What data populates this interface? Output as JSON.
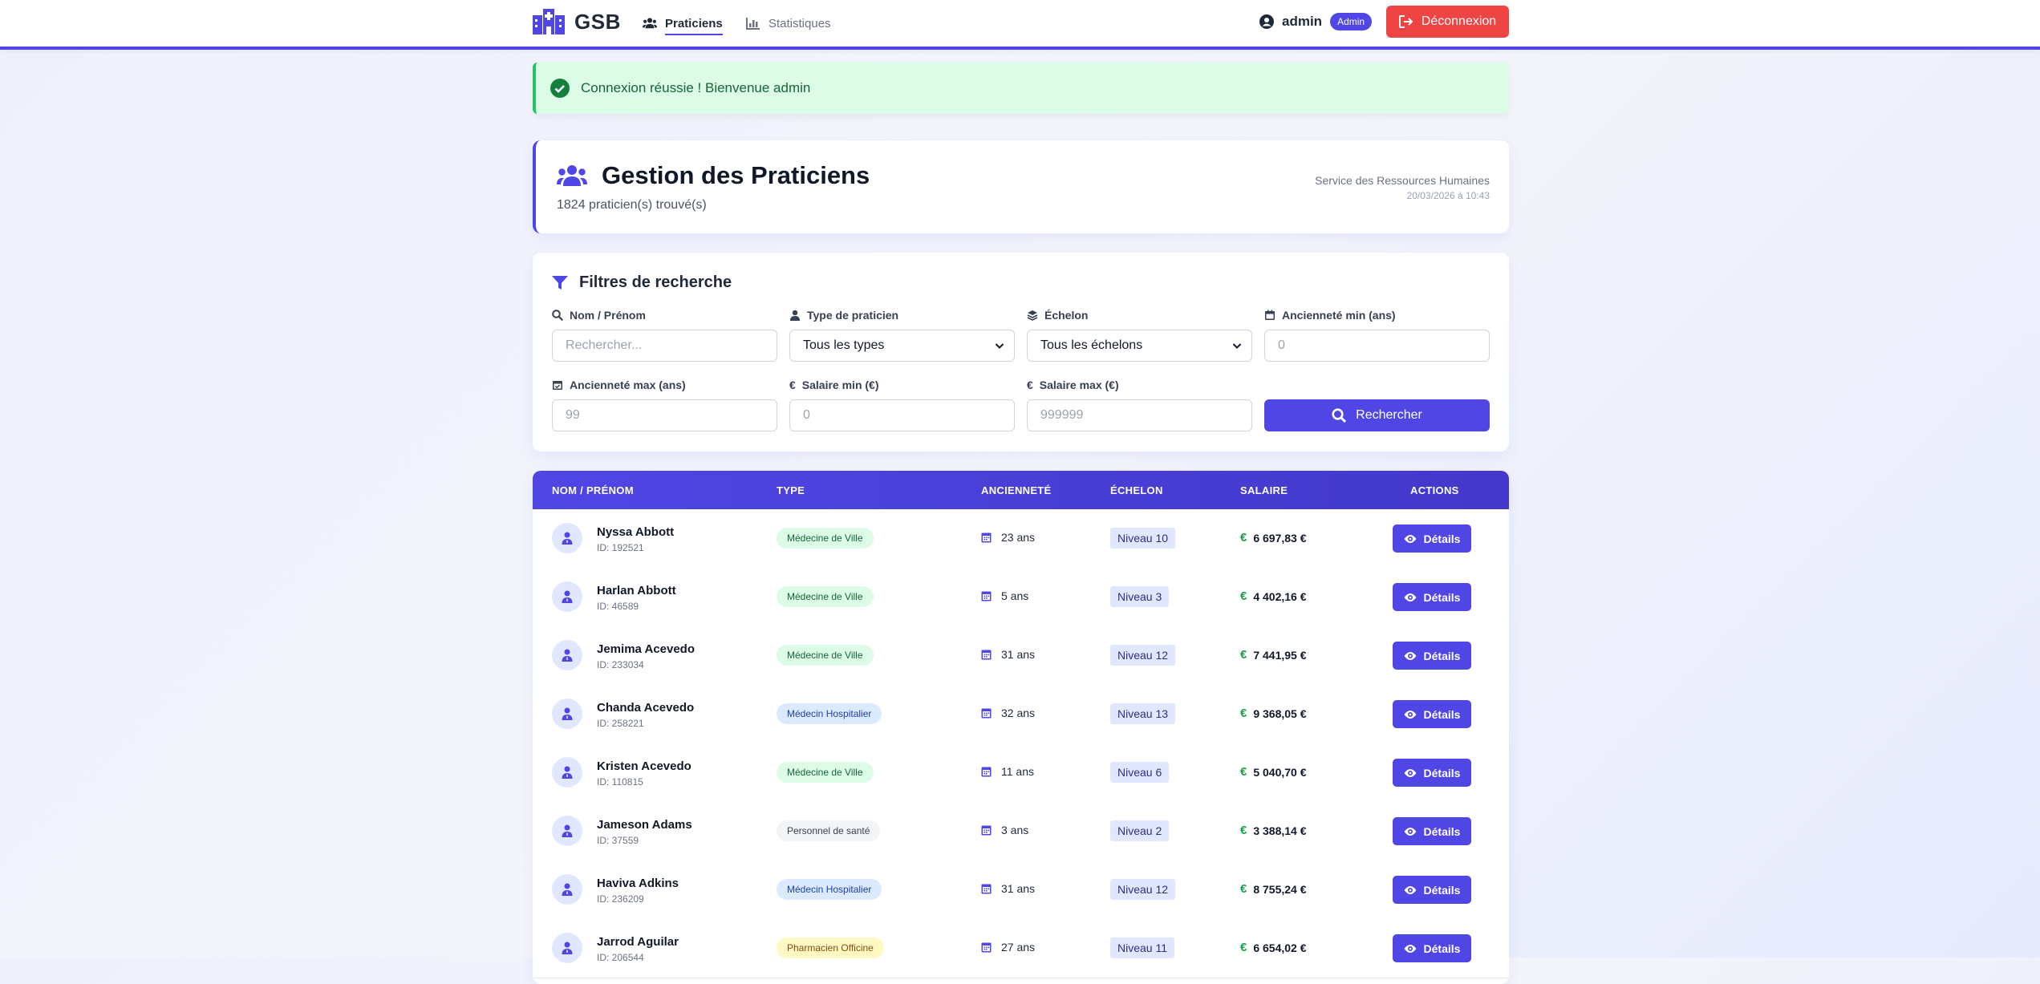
{
  "navbar": {
    "brand": "GSB",
    "links": [
      {
        "label": "Praticiens",
        "active": true
      },
      {
        "label": "Statistiques",
        "active": false
      }
    ],
    "user": "admin",
    "role_badge": "Admin",
    "logout_label": "Déconnexion"
  },
  "alert": {
    "message": "Connexion réussie ! Bienvenue admin"
  },
  "header": {
    "title": "Gestion des Praticiens",
    "count": "1824 praticien(s) trouvé(s)",
    "department": "Service des Ressources Humaines",
    "datetime": "20/03/2026 à 10:43"
  },
  "filters": {
    "title": "Filtres de recherche",
    "name_label": "Nom / Prénom",
    "name_placeholder": "Rechercher...",
    "type_label": "Type de praticien",
    "type_value": "Tous les types",
    "echelon_label": "Échelon",
    "echelon_value": "Tous les échelons",
    "anc_min_label": "Ancienneté min (ans)",
    "anc_min_placeholder": "0",
    "anc_max_label": "Ancienneté max (ans)",
    "anc_max_placeholder": "99",
    "sal_min_label": "Salaire min (€)",
    "sal_min_placeholder": "0",
    "sal_max_label": "Salaire max (€)",
    "sal_max_placeholder": "999999",
    "search_label": "Rechercher"
  },
  "table": {
    "headers": [
      "NOM / PRÉNOM",
      "TYPE",
      "ANCIENNETÉ",
      "ÉCHELON",
      "SALAIRE",
      "ACTIONS"
    ],
    "details_label": "Détails",
    "currency_symbol": "€",
    "rows": [
      {
        "name": "Nyssa Abbott",
        "id": "ID: 192521",
        "type": "Médecine de Ville",
        "type_kind": "ville",
        "anciennete": "23 ans",
        "echelon": "Niveau 10",
        "salaire": "6 697,83 €"
      },
      {
        "name": "Harlan Abbott",
        "id": "ID: 46589",
        "type": "Médecine de Ville",
        "type_kind": "ville",
        "anciennete": "5 ans",
        "echelon": "Niveau 3",
        "salaire": "4 402,16 €"
      },
      {
        "name": "Jemima Acevedo",
        "id": "ID: 233034",
        "type": "Médecine de Ville",
        "type_kind": "ville",
        "anciennete": "31 ans",
        "echelon": "Niveau 12",
        "salaire": "7 441,95 €"
      },
      {
        "name": "Chanda Acevedo",
        "id": "ID: 258221",
        "type": "Médecin Hospitalier",
        "type_kind": "hosp",
        "anciennete": "32 ans",
        "echelon": "Niveau 13",
        "salaire": "9 368,05 €"
      },
      {
        "name": "Kristen Acevedo",
        "id": "ID: 110815",
        "type": "Médecine de Ville",
        "type_kind": "ville",
        "anciennete": "11 ans",
        "echelon": "Niveau 6",
        "salaire": "5 040,70 €"
      },
      {
        "name": "Jameson Adams",
        "id": "ID: 37559",
        "type": "Personnel de santé",
        "type_kind": "perso",
        "anciennete": "3 ans",
        "echelon": "Niveau 2",
        "salaire": "3 388,14 €"
      },
      {
        "name": "Haviva Adkins",
        "id": "ID: 236209",
        "type": "Médecin Hospitalier",
        "type_kind": "hosp",
        "anciennete": "31 ans",
        "echelon": "Niveau 12",
        "salaire": "8 755,24 €"
      },
      {
        "name": "Jarrod Aguilar",
        "id": "ID: 206544",
        "type": "Pharmacien Officine",
        "type_kind": "pharma",
        "anciennete": "27 ans",
        "echelon": "Niveau 11",
        "salaire": "6 654,02 €"
      }
    ]
  },
  "colors": {
    "accent": "#4f46e5",
    "danger": "#ef4444",
    "success": "#22c55e",
    "badge_ville_bg": "#dcfce7",
    "badge_ville_fg": "#166534",
    "badge_hosp_bg": "#dbeafe",
    "badge_hosp_fg": "#1e40af",
    "badge_perso_bg": "#f3f4f6",
    "badge_perso_fg": "#374151",
    "badge_pharma_bg": "#fef9c3",
    "badge_pharma_fg": "#854d0e"
  },
  "icons": {
    "brand": "hospital-icon",
    "praticiens": "users-icon",
    "statistiques": "chart-icon",
    "user": "user-circle-icon",
    "logout": "sign-out-icon",
    "alert": "check-circle-icon",
    "filter": "filter-icon",
    "calendar": "calendar-icon",
    "euro": "euro-icon",
    "details": "eye-icon"
  }
}
